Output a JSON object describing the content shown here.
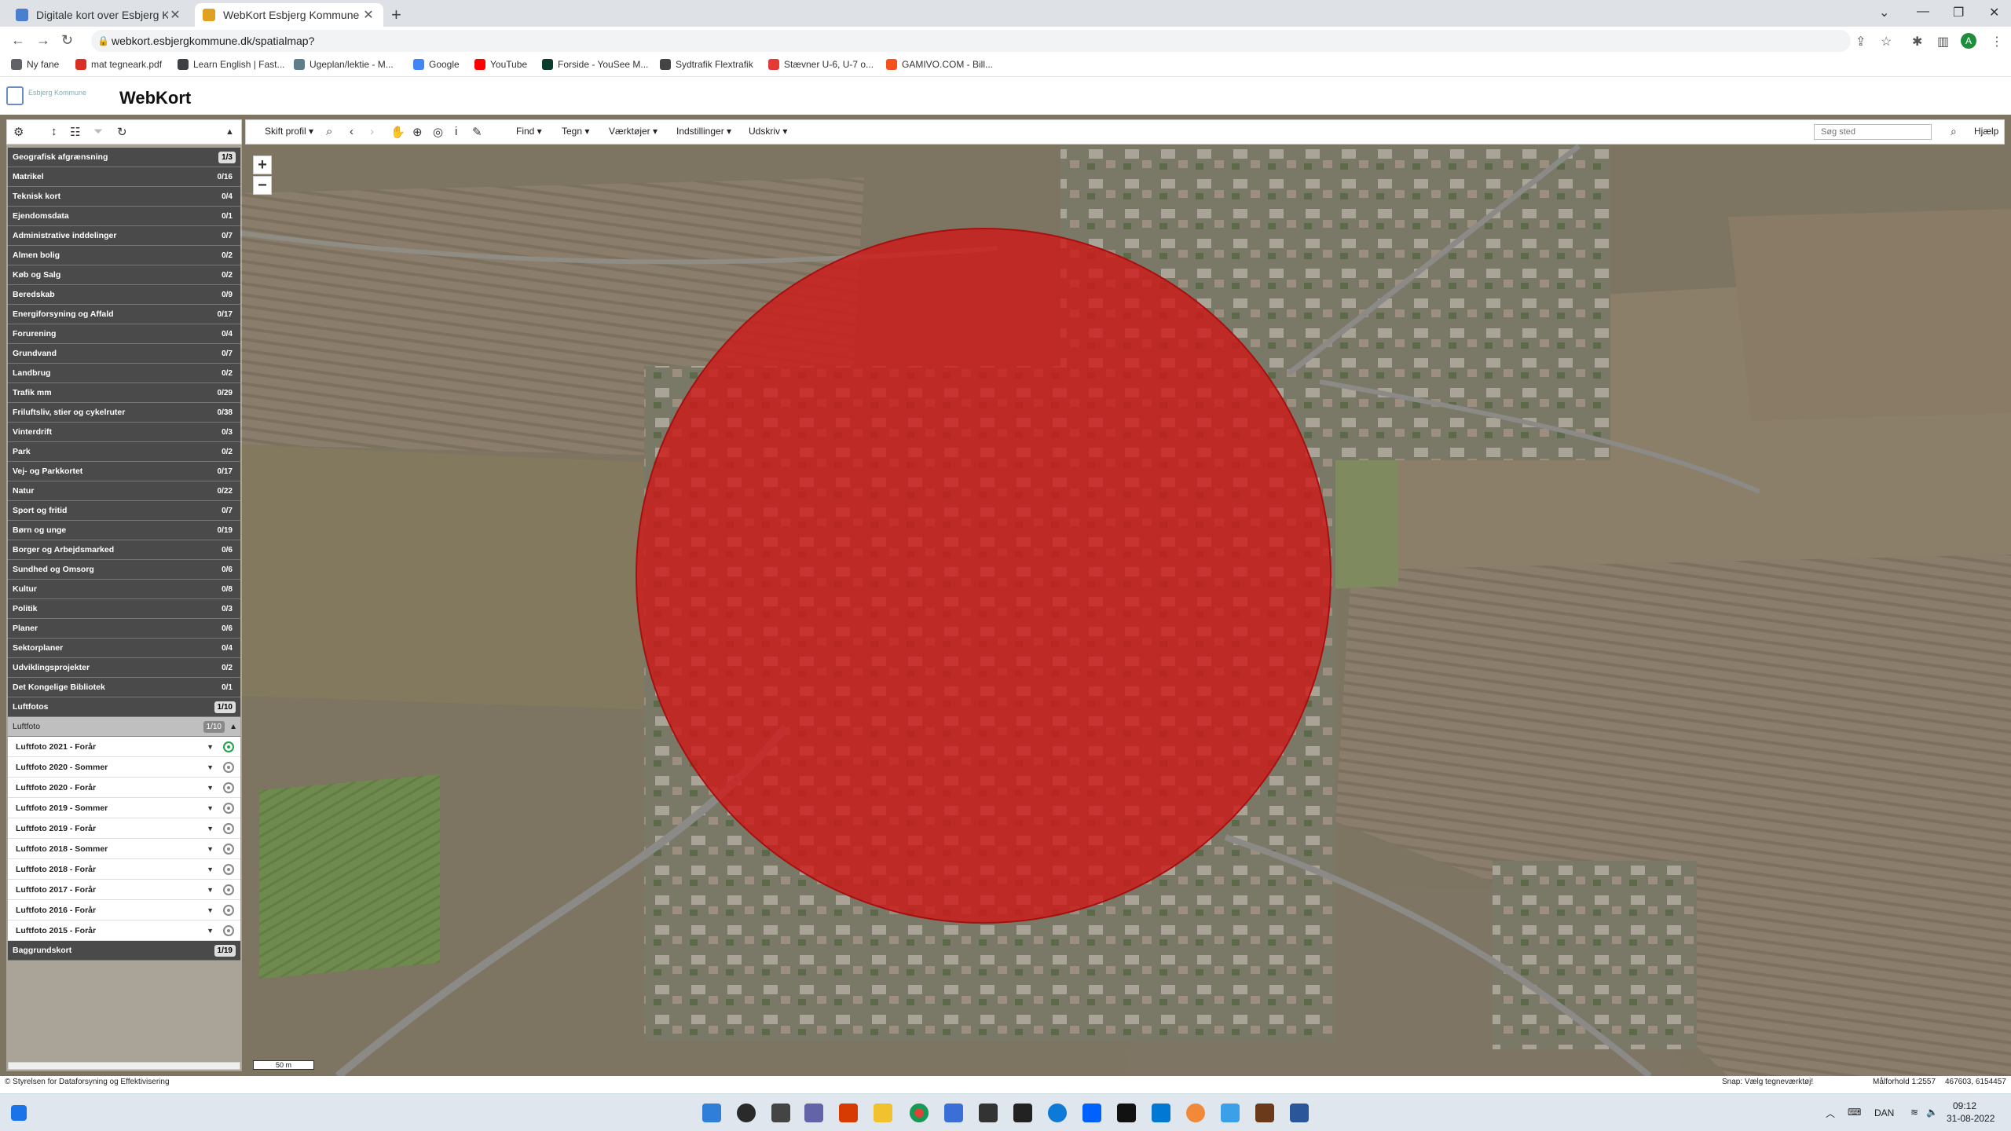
{
  "browser": {
    "tabs": [
      {
        "title": "Digitale kort over Esbjerg Komm",
        "active": false
      },
      {
        "title": "WebKort Esbjerg Kommune",
        "active": true
      }
    ],
    "url": "webkort.esbjergkommune.dk/spatialmap?",
    "avatar_letter": "A",
    "bookmarks": [
      {
        "label": "Ny fane",
        "color": "#5f6368"
      },
      {
        "label": "mat tegneark.pdf",
        "color": "#d93025"
      },
      {
        "label": "Learn English | Fast...",
        "color": "#3c4043"
      },
      {
        "label": "Ugeplan/lektie - M...",
        "color": "#607d8b"
      },
      {
        "label": "Google",
        "color": "#4285f4"
      },
      {
        "label": "YouTube",
        "color": "#ff0000"
      },
      {
        "label": "Forside - YouSee M...",
        "color": "#0b3d2e"
      },
      {
        "label": "Sydtrafik Flextrafik",
        "color": "#444444"
      },
      {
        "label": "Stævner U-6, U-7 o...",
        "color": "#e53935"
      },
      {
        "label": "GAMIVO.COM - Bill...",
        "color": "#f4511e"
      }
    ]
  },
  "app": {
    "logo_text": "Esbjerg Kommune",
    "title": "WebKort"
  },
  "toolbar": {
    "profile": "Skift profil",
    "find": "Find",
    "draw": "Tegn",
    "tools": "Værktøjer",
    "settings": "Indstillinger",
    "print": "Udskriv",
    "search_placeholder": "Søg sted",
    "help": "Hjælp"
  },
  "layers": [
    {
      "name": "Geografisk afgrænsning",
      "count": "1/3",
      "active": true
    },
    {
      "name": "Matrikel",
      "count": "0/16"
    },
    {
      "name": "Teknisk kort",
      "count": "0/4"
    },
    {
      "name": "Ejendomsdata",
      "count": "0/1"
    },
    {
      "name": "Administrative inddelinger",
      "count": "0/7"
    },
    {
      "name": "Almen bolig",
      "count": "0/2"
    },
    {
      "name": "Køb og Salg",
      "count": "0/2"
    },
    {
      "name": "Beredskab",
      "count": "0/9"
    },
    {
      "name": "Energiforsyning og Affald",
      "count": "0/17"
    },
    {
      "name": "Forurening",
      "count": "0/4"
    },
    {
      "name": "Grundvand",
      "count": "0/7"
    },
    {
      "name": "Landbrug",
      "count": "0/2"
    },
    {
      "name": "Trafik mm",
      "count": "0/29"
    },
    {
      "name": "Friluftsliv, stier og cykelruter",
      "count": "0/38"
    },
    {
      "name": "Vinterdrift",
      "count": "0/3"
    },
    {
      "name": "Park",
      "count": "0/2"
    },
    {
      "name": "Vej- og Parkkortet",
      "count": "0/17"
    },
    {
      "name": "Natur",
      "count": "0/22"
    },
    {
      "name": "Sport og fritid",
      "count": "0/7"
    },
    {
      "name": "Børn og unge",
      "count": "0/19"
    },
    {
      "name": "Borger og Arbejdsmarked",
      "count": "0/6"
    },
    {
      "name": "Sundhed og Omsorg",
      "count": "0/6"
    },
    {
      "name": "Kultur",
      "count": "0/8"
    },
    {
      "name": "Politik",
      "count": "0/3"
    },
    {
      "name": "Planer",
      "count": "0/6"
    },
    {
      "name": "Sektorplaner",
      "count": "0/4"
    },
    {
      "name": "Udviklingsprojekter",
      "count": "0/2"
    },
    {
      "name": "Det Kongelige Bibliotek",
      "count": "0/1"
    },
    {
      "name": "Luftfotos",
      "count": "1/10",
      "active": true
    }
  ],
  "open_group": {
    "name": "Luftfoto",
    "count": "1/10",
    "items": [
      {
        "name": "Luftfoto 2021 - Forår",
        "selected": true
      },
      {
        "name": "Luftfoto 2020 - Sommer",
        "selected": false
      },
      {
        "name": "Luftfoto 2020 - Forår",
        "selected": false
      },
      {
        "name": "Luftfoto 2019 - Sommer",
        "selected": false
      },
      {
        "name": "Luftfoto 2019 - Forår",
        "selected": false
      },
      {
        "name": "Luftfoto 2018 - Sommer",
        "selected": false
      },
      {
        "name": "Luftfoto 2018 - Forår",
        "selected": false
      },
      {
        "name": "Luftfoto 2017 - Forår",
        "selected": false
      },
      {
        "name": "Luftfoto 2016 - Forår",
        "selected": false
      },
      {
        "name": "Luftfoto 2015 - Forår",
        "selected": false
      }
    ]
  },
  "last_layer": {
    "name": "Baggrundskort",
    "count": "1/19"
  },
  "map": {
    "scale_text": "50 m",
    "circle_fill": "#d01818"
  },
  "status": {
    "copyright": "© Styrelsen for Dataforsyning og Effektivisering",
    "snap": "Snap: Vælg tegneværktøj!",
    "scale": "Målforhold 1:2557",
    "coords": "467603, 6154457"
  },
  "taskbar": {
    "lang": "DAN",
    "time": "09:12",
    "date": "31-08-2022"
  }
}
